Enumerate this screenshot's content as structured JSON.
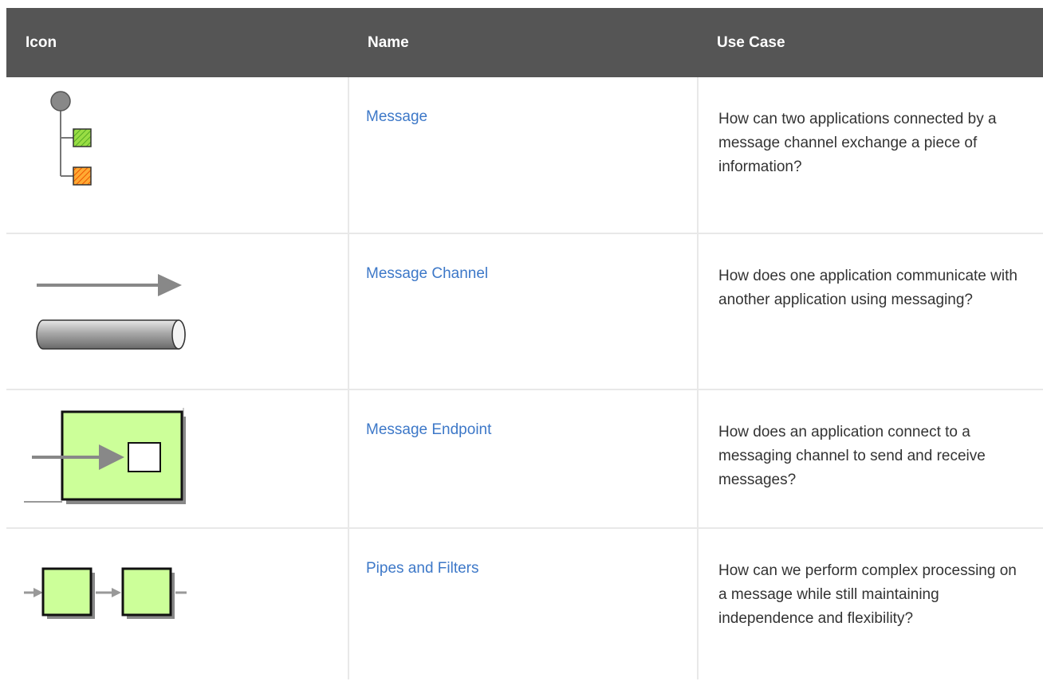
{
  "table": {
    "headers": {
      "icon": "Icon",
      "name": "Name",
      "use_case": "Use Case"
    },
    "rows": [
      {
        "icon": "message-icon",
        "name": "Message",
        "use_case": "How can two applications connected by a message channel exchange a piece of information?"
      },
      {
        "icon": "message-channel-icon",
        "name": "Message Channel",
        "use_case": "How does one application communicate with another application using messaging?"
      },
      {
        "icon": "message-endpoint-icon",
        "name": "Message Endpoint",
        "use_case": "How does an application connect to a messaging channel to send and receive messages?"
      },
      {
        "icon": "pipes-and-filters-icon",
        "name": "Pipes and Filters",
        "use_case": "How can we perform complex processing on a message while still maintaining independence and flexibility?"
      }
    ]
  },
  "colors": {
    "header_bg": "#555555",
    "link": "#3d78c8",
    "text": "#333333",
    "grid": "#e8e8e8",
    "endpoint_fill": "#ccff99",
    "arrow_gray": "#888888"
  }
}
